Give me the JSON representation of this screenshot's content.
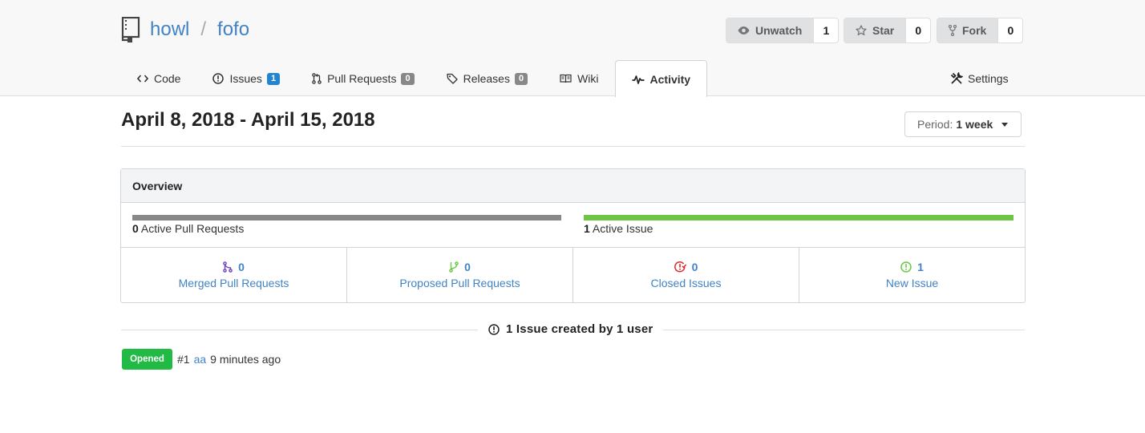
{
  "repo": {
    "owner": "howl",
    "separator": "/",
    "name": "fofo"
  },
  "actions": {
    "watch": {
      "label": "Unwatch",
      "count": "1"
    },
    "star": {
      "label": "Star",
      "count": "0"
    },
    "fork": {
      "label": "Fork",
      "count": "0"
    }
  },
  "tabs": [
    {
      "label": "Code",
      "icon": "code-icon"
    },
    {
      "label": "Issues",
      "icon": "issue-opened-icon",
      "badge": "1"
    },
    {
      "label": "Pull Requests",
      "icon": "git-pull-request-icon",
      "badge": "0"
    },
    {
      "label": "Releases",
      "icon": "tag-icon",
      "badge": "0"
    },
    {
      "label": "Wiki",
      "icon": "book-icon"
    },
    {
      "label": "Activity",
      "icon": "pulse-icon",
      "active": true
    }
  ],
  "settings_tab": {
    "label": "Settings",
    "icon": "tools-icon"
  },
  "date_range": "April 8, 2018 - April 15, 2018",
  "period": {
    "label": "Period:",
    "value": "1 week"
  },
  "overview": {
    "title": "Overview",
    "pull_requests": {
      "count": "0",
      "label": "Active Pull Requests",
      "fill": 0,
      "color": "#888888"
    },
    "issues": {
      "count": "1",
      "label": "Active Issue",
      "fill": 1.0,
      "color": "#6cc644"
    },
    "stats": [
      {
        "count": "0",
        "label": "Merged Pull Requests",
        "icon": "git-merge-icon",
        "color": "#6f42c1"
      },
      {
        "count": "0",
        "label": "Proposed Pull Requests",
        "icon": "git-branch-icon",
        "color": "#6cc644"
      },
      {
        "count": "0",
        "label": "Closed Issues",
        "icon": "issue-closed-icon",
        "color": "#db2828"
      },
      {
        "count": "1",
        "label": "New Issue",
        "icon": "issue-opened-icon",
        "color": "#6cc644"
      }
    ]
  },
  "summary": {
    "text": "1 Issue created by 1 user",
    "icon": "issue-opened-icon"
  },
  "issue": {
    "status": "Opened",
    "number": "#1",
    "title": "aa",
    "time": "9 minutes ago",
    "status_color": "#21ba45"
  }
}
